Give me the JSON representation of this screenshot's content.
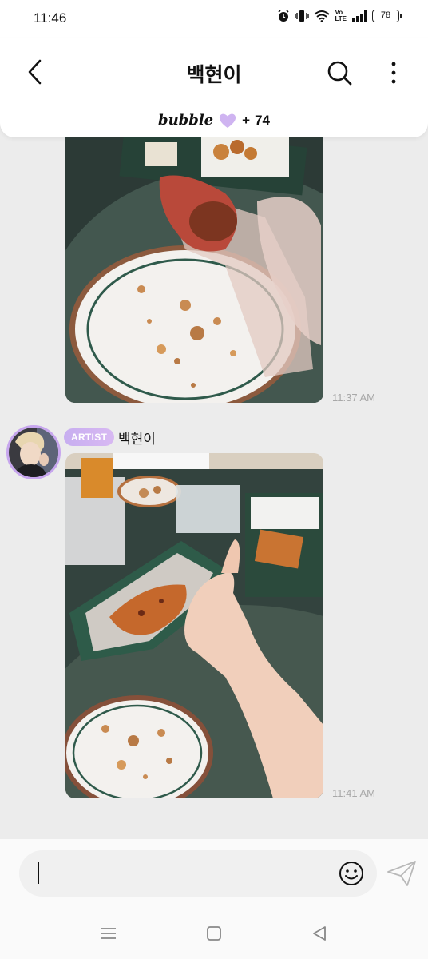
{
  "status_bar": {
    "time": "11:46",
    "volte_top": "Vo",
    "volte_bottom": "LTE",
    "battery": "78"
  },
  "header": {
    "title": "백현이",
    "bubble_label": "bubble",
    "bubble_plus": "+",
    "bubble_count": "74"
  },
  "messages": [
    {
      "type": "photo",
      "time": "11:37 AM"
    },
    {
      "type": "photo",
      "sender_badge": "ARTIST",
      "sender_name": "백현이",
      "time": "11:41 AM"
    }
  ],
  "composer": {
    "placeholder": "",
    "value": ""
  },
  "colors": {
    "accent": "#c7a6ee",
    "chat_bg": "#ececec",
    "time_text": "#a8a8a8"
  },
  "icons": {
    "back": "chevron-left-icon",
    "search": "search-icon",
    "more": "more-vertical-icon",
    "heart": "heart-icon",
    "emoji": "emoji-icon",
    "send": "send-icon",
    "nav_menu": "recent-apps-icon",
    "nav_home": "home-icon",
    "nav_back": "back-triangle-icon"
  }
}
